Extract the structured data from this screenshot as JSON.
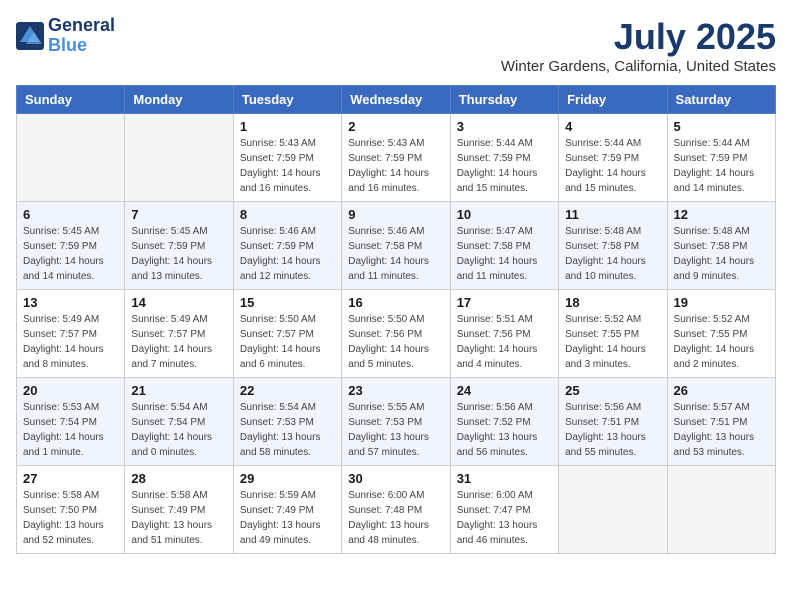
{
  "header": {
    "logo_line1": "General",
    "logo_line2": "Blue",
    "month_year": "July 2025",
    "location": "Winter Gardens, California, United States"
  },
  "weekdays": [
    "Sunday",
    "Monday",
    "Tuesday",
    "Wednesday",
    "Thursday",
    "Friday",
    "Saturday"
  ],
  "weeks": [
    [
      {
        "day": "",
        "sunrise": "",
        "sunset": "",
        "daylight": ""
      },
      {
        "day": "",
        "sunrise": "",
        "sunset": "",
        "daylight": ""
      },
      {
        "day": "1",
        "sunrise": "Sunrise: 5:43 AM",
        "sunset": "Sunset: 7:59 PM",
        "daylight": "Daylight: 14 hours and 16 minutes."
      },
      {
        "day": "2",
        "sunrise": "Sunrise: 5:43 AM",
        "sunset": "Sunset: 7:59 PM",
        "daylight": "Daylight: 14 hours and 16 minutes."
      },
      {
        "day": "3",
        "sunrise": "Sunrise: 5:44 AM",
        "sunset": "Sunset: 7:59 PM",
        "daylight": "Daylight: 14 hours and 15 minutes."
      },
      {
        "day": "4",
        "sunrise": "Sunrise: 5:44 AM",
        "sunset": "Sunset: 7:59 PM",
        "daylight": "Daylight: 14 hours and 15 minutes."
      },
      {
        "day": "5",
        "sunrise": "Sunrise: 5:44 AM",
        "sunset": "Sunset: 7:59 PM",
        "daylight": "Daylight: 14 hours and 14 minutes."
      }
    ],
    [
      {
        "day": "6",
        "sunrise": "Sunrise: 5:45 AM",
        "sunset": "Sunset: 7:59 PM",
        "daylight": "Daylight: 14 hours and 14 minutes."
      },
      {
        "day": "7",
        "sunrise": "Sunrise: 5:45 AM",
        "sunset": "Sunset: 7:59 PM",
        "daylight": "Daylight: 14 hours and 13 minutes."
      },
      {
        "day": "8",
        "sunrise": "Sunrise: 5:46 AM",
        "sunset": "Sunset: 7:59 PM",
        "daylight": "Daylight: 14 hours and 12 minutes."
      },
      {
        "day": "9",
        "sunrise": "Sunrise: 5:46 AM",
        "sunset": "Sunset: 7:58 PM",
        "daylight": "Daylight: 14 hours and 11 minutes."
      },
      {
        "day": "10",
        "sunrise": "Sunrise: 5:47 AM",
        "sunset": "Sunset: 7:58 PM",
        "daylight": "Daylight: 14 hours and 11 minutes."
      },
      {
        "day": "11",
        "sunrise": "Sunrise: 5:48 AM",
        "sunset": "Sunset: 7:58 PM",
        "daylight": "Daylight: 14 hours and 10 minutes."
      },
      {
        "day": "12",
        "sunrise": "Sunrise: 5:48 AM",
        "sunset": "Sunset: 7:58 PM",
        "daylight": "Daylight: 14 hours and 9 minutes."
      }
    ],
    [
      {
        "day": "13",
        "sunrise": "Sunrise: 5:49 AM",
        "sunset": "Sunset: 7:57 PM",
        "daylight": "Daylight: 14 hours and 8 minutes."
      },
      {
        "day": "14",
        "sunrise": "Sunrise: 5:49 AM",
        "sunset": "Sunset: 7:57 PM",
        "daylight": "Daylight: 14 hours and 7 minutes."
      },
      {
        "day": "15",
        "sunrise": "Sunrise: 5:50 AM",
        "sunset": "Sunset: 7:57 PM",
        "daylight": "Daylight: 14 hours and 6 minutes."
      },
      {
        "day": "16",
        "sunrise": "Sunrise: 5:50 AM",
        "sunset": "Sunset: 7:56 PM",
        "daylight": "Daylight: 14 hours and 5 minutes."
      },
      {
        "day": "17",
        "sunrise": "Sunrise: 5:51 AM",
        "sunset": "Sunset: 7:56 PM",
        "daylight": "Daylight: 14 hours and 4 minutes."
      },
      {
        "day": "18",
        "sunrise": "Sunrise: 5:52 AM",
        "sunset": "Sunset: 7:55 PM",
        "daylight": "Daylight: 14 hours and 3 minutes."
      },
      {
        "day": "19",
        "sunrise": "Sunrise: 5:52 AM",
        "sunset": "Sunset: 7:55 PM",
        "daylight": "Daylight: 14 hours and 2 minutes."
      }
    ],
    [
      {
        "day": "20",
        "sunrise": "Sunrise: 5:53 AM",
        "sunset": "Sunset: 7:54 PM",
        "daylight": "Daylight: 14 hours and 1 minute."
      },
      {
        "day": "21",
        "sunrise": "Sunrise: 5:54 AM",
        "sunset": "Sunset: 7:54 PM",
        "daylight": "Daylight: 14 hours and 0 minutes."
      },
      {
        "day": "22",
        "sunrise": "Sunrise: 5:54 AM",
        "sunset": "Sunset: 7:53 PM",
        "daylight": "Daylight: 13 hours and 58 minutes."
      },
      {
        "day": "23",
        "sunrise": "Sunrise: 5:55 AM",
        "sunset": "Sunset: 7:53 PM",
        "daylight": "Daylight: 13 hours and 57 minutes."
      },
      {
        "day": "24",
        "sunrise": "Sunrise: 5:56 AM",
        "sunset": "Sunset: 7:52 PM",
        "daylight": "Daylight: 13 hours and 56 minutes."
      },
      {
        "day": "25",
        "sunrise": "Sunrise: 5:56 AM",
        "sunset": "Sunset: 7:51 PM",
        "daylight": "Daylight: 13 hours and 55 minutes."
      },
      {
        "day": "26",
        "sunrise": "Sunrise: 5:57 AM",
        "sunset": "Sunset: 7:51 PM",
        "daylight": "Daylight: 13 hours and 53 minutes."
      }
    ],
    [
      {
        "day": "27",
        "sunrise": "Sunrise: 5:58 AM",
        "sunset": "Sunset: 7:50 PM",
        "daylight": "Daylight: 13 hours and 52 minutes."
      },
      {
        "day": "28",
        "sunrise": "Sunrise: 5:58 AM",
        "sunset": "Sunset: 7:49 PM",
        "daylight": "Daylight: 13 hours and 51 minutes."
      },
      {
        "day": "29",
        "sunrise": "Sunrise: 5:59 AM",
        "sunset": "Sunset: 7:49 PM",
        "daylight": "Daylight: 13 hours and 49 minutes."
      },
      {
        "day": "30",
        "sunrise": "Sunrise: 6:00 AM",
        "sunset": "Sunset: 7:48 PM",
        "daylight": "Daylight: 13 hours and 48 minutes."
      },
      {
        "day": "31",
        "sunrise": "Sunrise: 6:00 AM",
        "sunset": "Sunset: 7:47 PM",
        "daylight": "Daylight: 13 hours and 46 minutes."
      },
      {
        "day": "",
        "sunrise": "",
        "sunset": "",
        "daylight": ""
      },
      {
        "day": "",
        "sunrise": "",
        "sunset": "",
        "daylight": ""
      }
    ]
  ]
}
